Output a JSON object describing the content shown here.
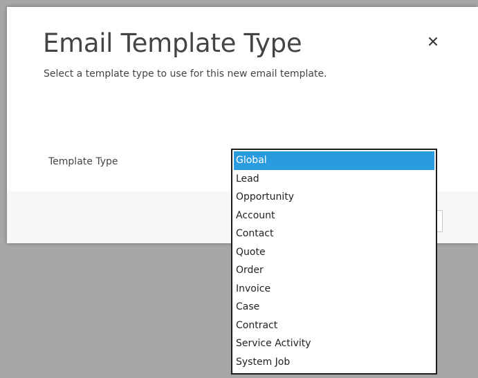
{
  "dialog": {
    "title": "Email Template Type",
    "subtitle": "Select a template type to use for this new email template.",
    "close_icon": "close-icon"
  },
  "form": {
    "template_type_label": "Template Type",
    "selected_value": "Global",
    "options": [
      "Global",
      "Lead",
      "Opportunity",
      "Account",
      "Contact",
      "Quote",
      "Order",
      "Invoice",
      "Case",
      "Contract",
      "Service Activity",
      "System Job"
    ]
  },
  "colors": {
    "highlight": "#2b9be0",
    "overlay": "#a7a7a7",
    "dialog_background": "#ffffff"
  }
}
